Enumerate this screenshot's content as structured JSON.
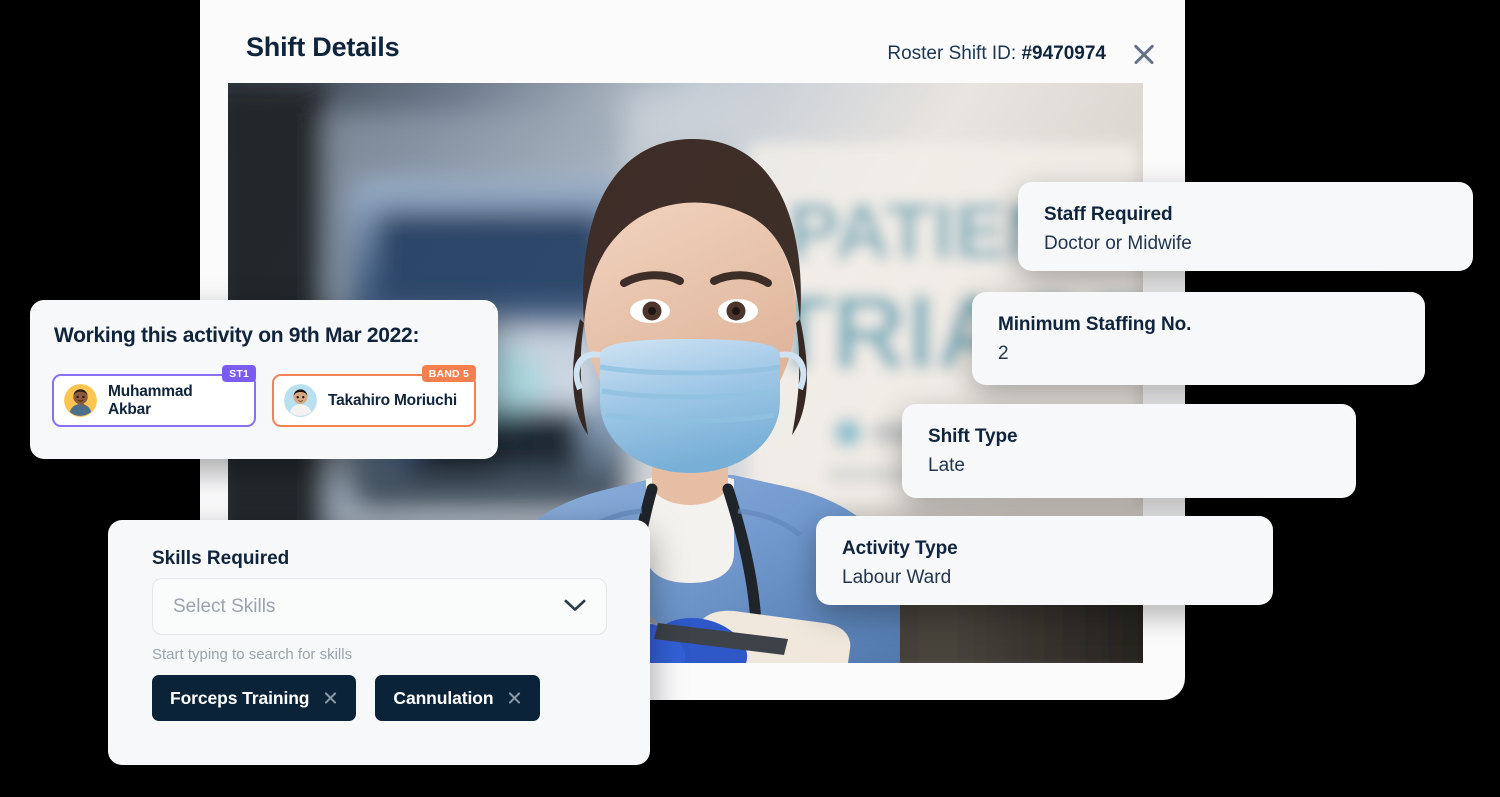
{
  "modal": {
    "title": "Shift Details",
    "roster_prefix": "Roster Shift ID: ",
    "roster_id": "#9470974",
    "close_icon": "close-icon"
  },
  "photo": {
    "alt": "Nurse wearing surgical mask and blue scrubs with stethoscope standing outside hospital",
    "background_sign_line1": "PATIENT",
    "background_sign_line2": "TRIAGE"
  },
  "info_cards": [
    {
      "label": "Staff Required",
      "value": "Doctor or Midwife"
    },
    {
      "label": "Minimum Staffing No.",
      "value": "2"
    },
    {
      "label": "Shift Type",
      "value": "Late"
    },
    {
      "label": "Activity Type",
      "value": "Labour Ward"
    }
  ],
  "working": {
    "title": "Working this activity on 9th Mar 2022:",
    "staff": [
      {
        "name_line1": "Muhammad",
        "name_line2": "Akbar",
        "badge": "ST1",
        "badge_color": "#7b5cf0",
        "border_color": "#8a6ff2"
      },
      {
        "name_line1": "Takahiro Moriuchi",
        "name_line2": "",
        "badge": "BAND 5",
        "badge_color": "#f5804f",
        "border_color": "#f58156"
      }
    ]
  },
  "skills": {
    "title": "Skills Required",
    "placeholder": "Select Skills",
    "hint": "Start typing to search for skills",
    "chevron_icon": "chevron-down-icon",
    "chips": [
      {
        "label": "Forceps Training",
        "remove_icon": "close-icon"
      },
      {
        "label": "Cannulation",
        "remove_icon": "close-icon"
      }
    ],
    "chip_bg": "#0b2339"
  }
}
